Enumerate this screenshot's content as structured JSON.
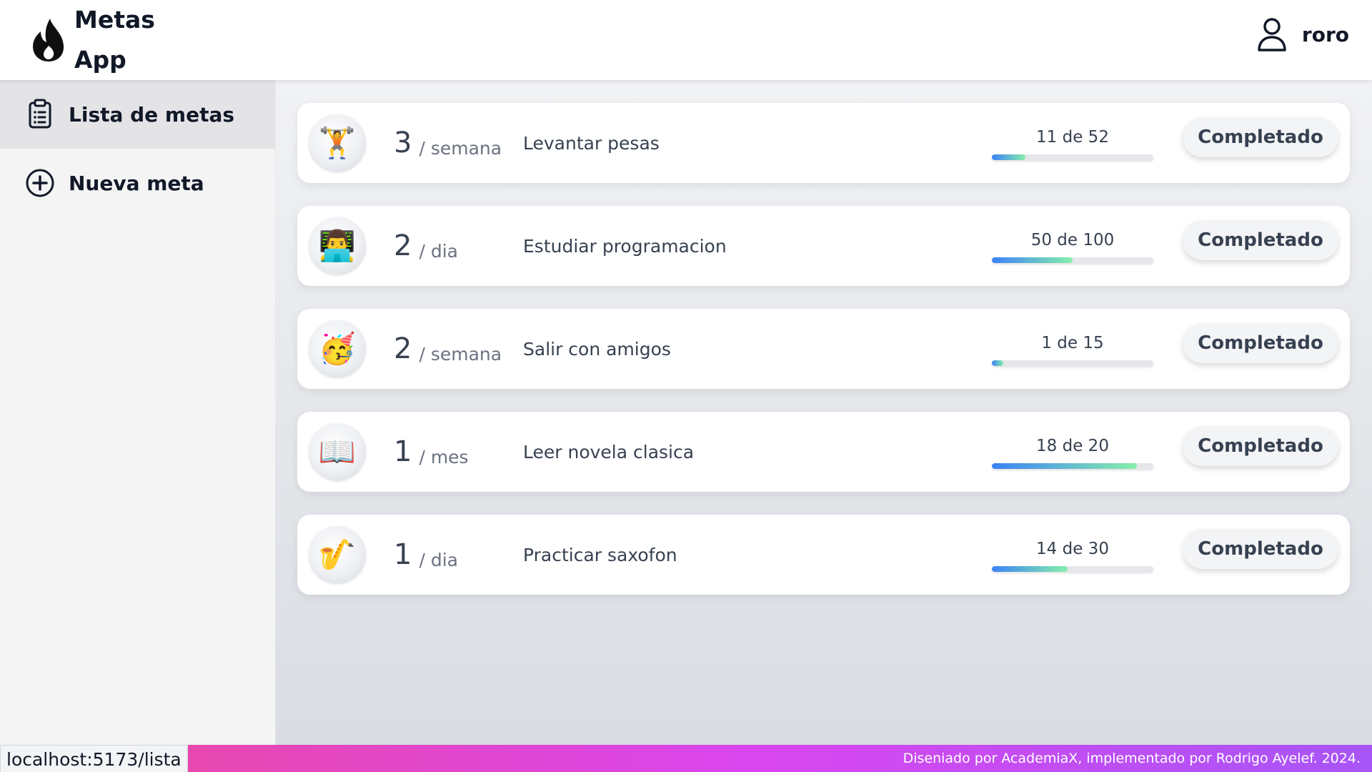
{
  "header": {
    "app_title": "Metas App",
    "brand_icon": "flame-icon",
    "user_icon": "user-icon",
    "username": "roro"
  },
  "sidebar": {
    "items": [
      {
        "label": "Lista de metas",
        "icon": "clipboard-list-icon",
        "active": true
      },
      {
        "label": "Nueva meta",
        "icon": "plus-circle-icon",
        "active": false
      }
    ]
  },
  "goals": [
    {
      "icon": "🏋️",
      "count": "3",
      "period": "/ semana",
      "title": "Levantar pesas",
      "progress_text": "11 de 52",
      "completed": 11,
      "target": 52,
      "button_label": "Completado"
    },
    {
      "icon": "👨‍💻",
      "count": "2",
      "period": "/ dia",
      "title": "Estudiar programacion",
      "progress_text": "50 de 100",
      "completed": 50,
      "target": 100,
      "button_label": "Completado"
    },
    {
      "icon": "🥳",
      "count": "2",
      "period": "/ semana",
      "title": "Salir con amigos",
      "progress_text": "1 de 15",
      "completed": 1,
      "target": 15,
      "button_label": "Completado"
    },
    {
      "icon": "📖",
      "count": "1",
      "period": "/ mes",
      "title": "Leer novela clasica",
      "progress_text": "18 de 20",
      "completed": 18,
      "target": 20,
      "button_label": "Completado"
    },
    {
      "icon": "🎷",
      "count": "1",
      "period": "/ dia",
      "title": "Practicar saxofon",
      "progress_text": "14 de 30",
      "completed": 14,
      "target": 30,
      "button_label": "Completado"
    }
  ],
  "footer": {
    "credits": "Diseniado por AcademiaX, implementado por Rodrigo Ayelef. 2024."
  },
  "status_bar": {
    "url": "localhost:5173/lista"
  },
  "colors": {
    "progress_start": "#3b82f6",
    "progress_end": "#86efac",
    "footer_start": "#ec4899",
    "footer_end": "#a855f7"
  }
}
